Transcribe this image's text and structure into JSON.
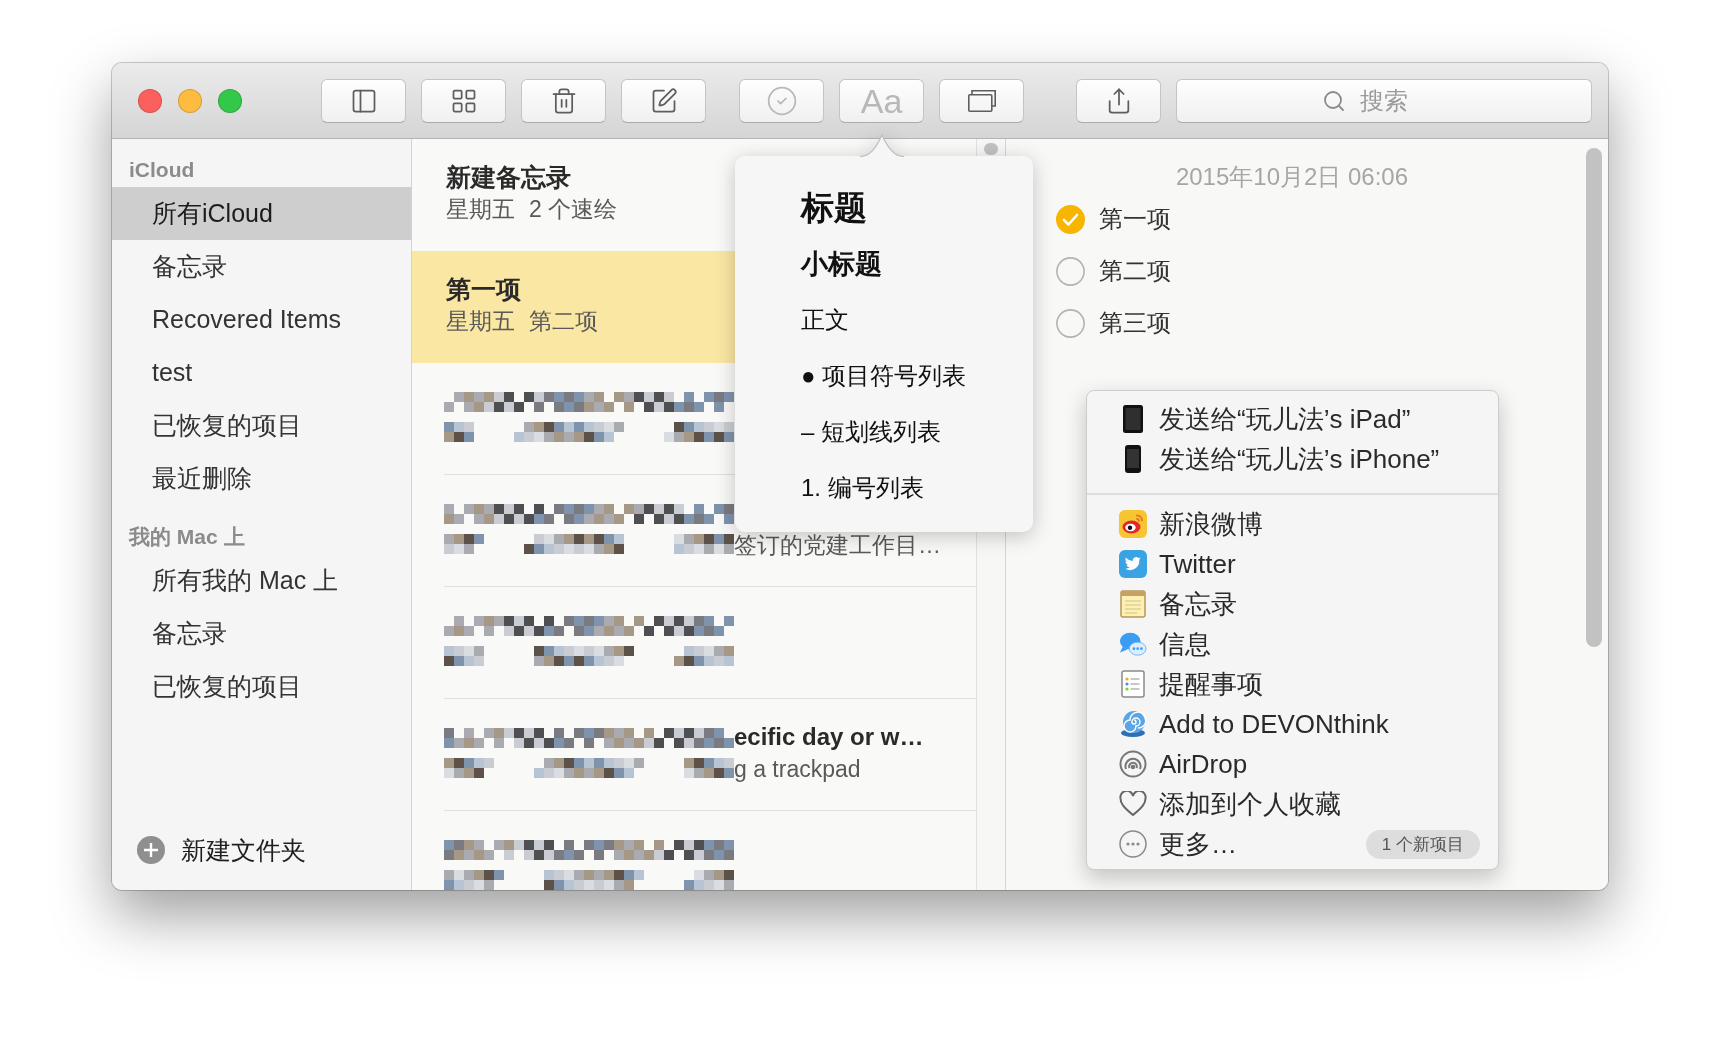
{
  "toolbar": {
    "groups": [
      [
        {
          "kind": "sidebar",
          "disabled": false
        },
        {
          "kind": "grid",
          "disabled": false
        },
        {
          "kind": "trash",
          "disabled": false
        },
        {
          "kind": "compose",
          "disabled": false
        }
      ],
      [
        {
          "kind": "checklist",
          "disabled": true
        },
        {
          "kind": "format",
          "label": "Aa",
          "disabled": true
        },
        {
          "kind": "window",
          "disabled": false
        }
      ],
      [
        {
          "kind": "share",
          "disabled": false
        }
      ]
    ],
    "search": {
      "placeholder": "搜索"
    }
  },
  "sidebar": {
    "sections": [
      {
        "title": "iCloud",
        "items": [
          {
            "label": "所有iCloud",
            "selected": true
          },
          {
            "label": "备忘录",
            "selected": false
          },
          {
            "label": "Recovered Items",
            "selected": false
          },
          {
            "label": "test",
            "selected": false
          },
          {
            "label": "已恢复的项目",
            "selected": false
          },
          {
            "label": "最近删除",
            "selected": false
          }
        ]
      },
      {
        "title": "我的 Mac 上",
        "items": [
          {
            "label": "所有我的 Mac 上",
            "selected": false
          },
          {
            "label": "备忘录",
            "selected": false
          },
          {
            "label": "已恢复的项目",
            "selected": false
          }
        ]
      }
    ],
    "new_folder": {
      "label": "新建文件夹"
    }
  },
  "note_list": {
    "notes": [
      {
        "kind": "note",
        "title": "新建备忘录",
        "date": "星期五",
        "preview": "2 个速绘",
        "selected": false
      },
      {
        "kind": "note",
        "title": "第一项",
        "date": "星期五",
        "preview": "第二项",
        "selected": true
      },
      {
        "kind": "pixelated",
        "selected": false
      },
      {
        "kind": "pixelated",
        "preview": "签订的党建工作目…",
        "selected": false
      },
      {
        "kind": "pixelated",
        "selected": false
      },
      {
        "kind": "pixelated",
        "title": "ecific day or w…",
        "preview": "g a trackpad",
        "selected": false
      },
      {
        "kind": "pixelated",
        "selected": false
      }
    ]
  },
  "note": {
    "date": "2015年10月2日 06:06",
    "checklist": [
      {
        "label": "第一项",
        "checked": true
      },
      {
        "label": "第二项",
        "checked": false
      },
      {
        "label": "第三项",
        "checked": false
      }
    ]
  },
  "format_popover": {
    "items": [
      {
        "kind": "title",
        "label": "标题"
      },
      {
        "kind": "heading",
        "label": "小标题"
      },
      {
        "kind": "body",
        "label": "正文"
      },
      {
        "kind": "bulleted",
        "label": "● 项目符号列表"
      },
      {
        "kind": "dashed",
        "label": "– 短划线列表"
      },
      {
        "kind": "numbered",
        "label": "1. 编号列表"
      }
    ]
  },
  "share_menu": {
    "groups": [
      [
        {
          "kind": "ipad",
          "label": "发送给“玩儿法’s iPad”"
        },
        {
          "kind": "iphone",
          "label": "发送给“玩儿法’s iPhone”"
        }
      ],
      [
        {
          "kind": "weibo",
          "label": "新浪微博"
        },
        {
          "kind": "twitter",
          "label": "Twitter"
        },
        {
          "kind": "notes",
          "label": "备忘录"
        },
        {
          "kind": "messages",
          "label": "信息"
        },
        {
          "kind": "reminders",
          "label": "提醒事项"
        },
        {
          "kind": "devonthink",
          "label": "Add to DEVONthink"
        },
        {
          "kind": "airdrop",
          "label": "AirDrop"
        },
        {
          "kind": "favorites",
          "label": "添加到个人收藏"
        },
        {
          "kind": "more",
          "label": "更多…",
          "badge": "1 个新项目"
        }
      ]
    ]
  }
}
